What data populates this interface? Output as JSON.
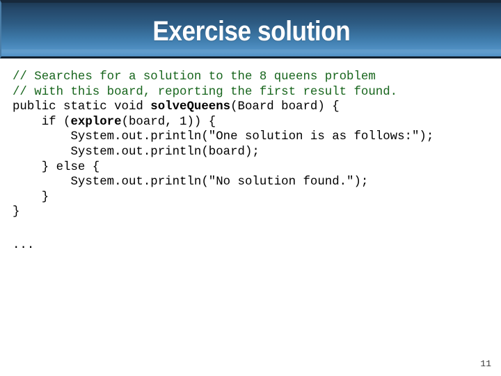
{
  "slide": {
    "title": "Exercise solution",
    "page_number": "11",
    "title_bar_gradient_top": "#1d3a55",
    "title_bar_gradient_bottom": "#5697cb",
    "title_color": "#ffffff",
    "background_color": "#ffffff",
    "comment_color": "#17651c",
    "code_color": "#000000"
  },
  "code": {
    "lines": [
      {
        "id": "line-1",
        "segments": [
          {
            "text": "// Searches for a solution to the 8 queens problem",
            "style": "comment"
          }
        ]
      },
      {
        "id": "line-2",
        "segments": [
          {
            "text": "// with this board, reporting the first result found.",
            "style": "comment"
          }
        ]
      },
      {
        "id": "line-3",
        "segments": [
          {
            "text": "public static void ",
            "style": "plain"
          },
          {
            "text": "solveQueens",
            "style": "bold"
          },
          {
            "text": "(Board board) {",
            "style": "plain"
          }
        ]
      },
      {
        "id": "line-4",
        "segments": [
          {
            "text": "    if (",
            "style": "plain"
          },
          {
            "text": "explore",
            "style": "bold"
          },
          {
            "text": "(board, 1)) {",
            "style": "plain"
          }
        ]
      },
      {
        "id": "line-5",
        "segments": [
          {
            "text": "        System.out.println(\"One solution is as follows:\");",
            "style": "plain"
          }
        ]
      },
      {
        "id": "line-6",
        "segments": [
          {
            "text": "        System.out.println(board);",
            "style": "plain"
          }
        ]
      },
      {
        "id": "line-7",
        "segments": [
          {
            "text": "    } else {",
            "style": "plain"
          }
        ]
      },
      {
        "id": "line-8",
        "segments": [
          {
            "text": "        System.out.println(\"No solution found.\");",
            "style": "plain"
          }
        ]
      },
      {
        "id": "line-9",
        "segments": [
          {
            "text": "    }",
            "style": "plain"
          }
        ]
      },
      {
        "id": "line-10",
        "segments": [
          {
            "text": "}",
            "style": "plain"
          }
        ]
      }
    ],
    "ellipsis": "..."
  }
}
